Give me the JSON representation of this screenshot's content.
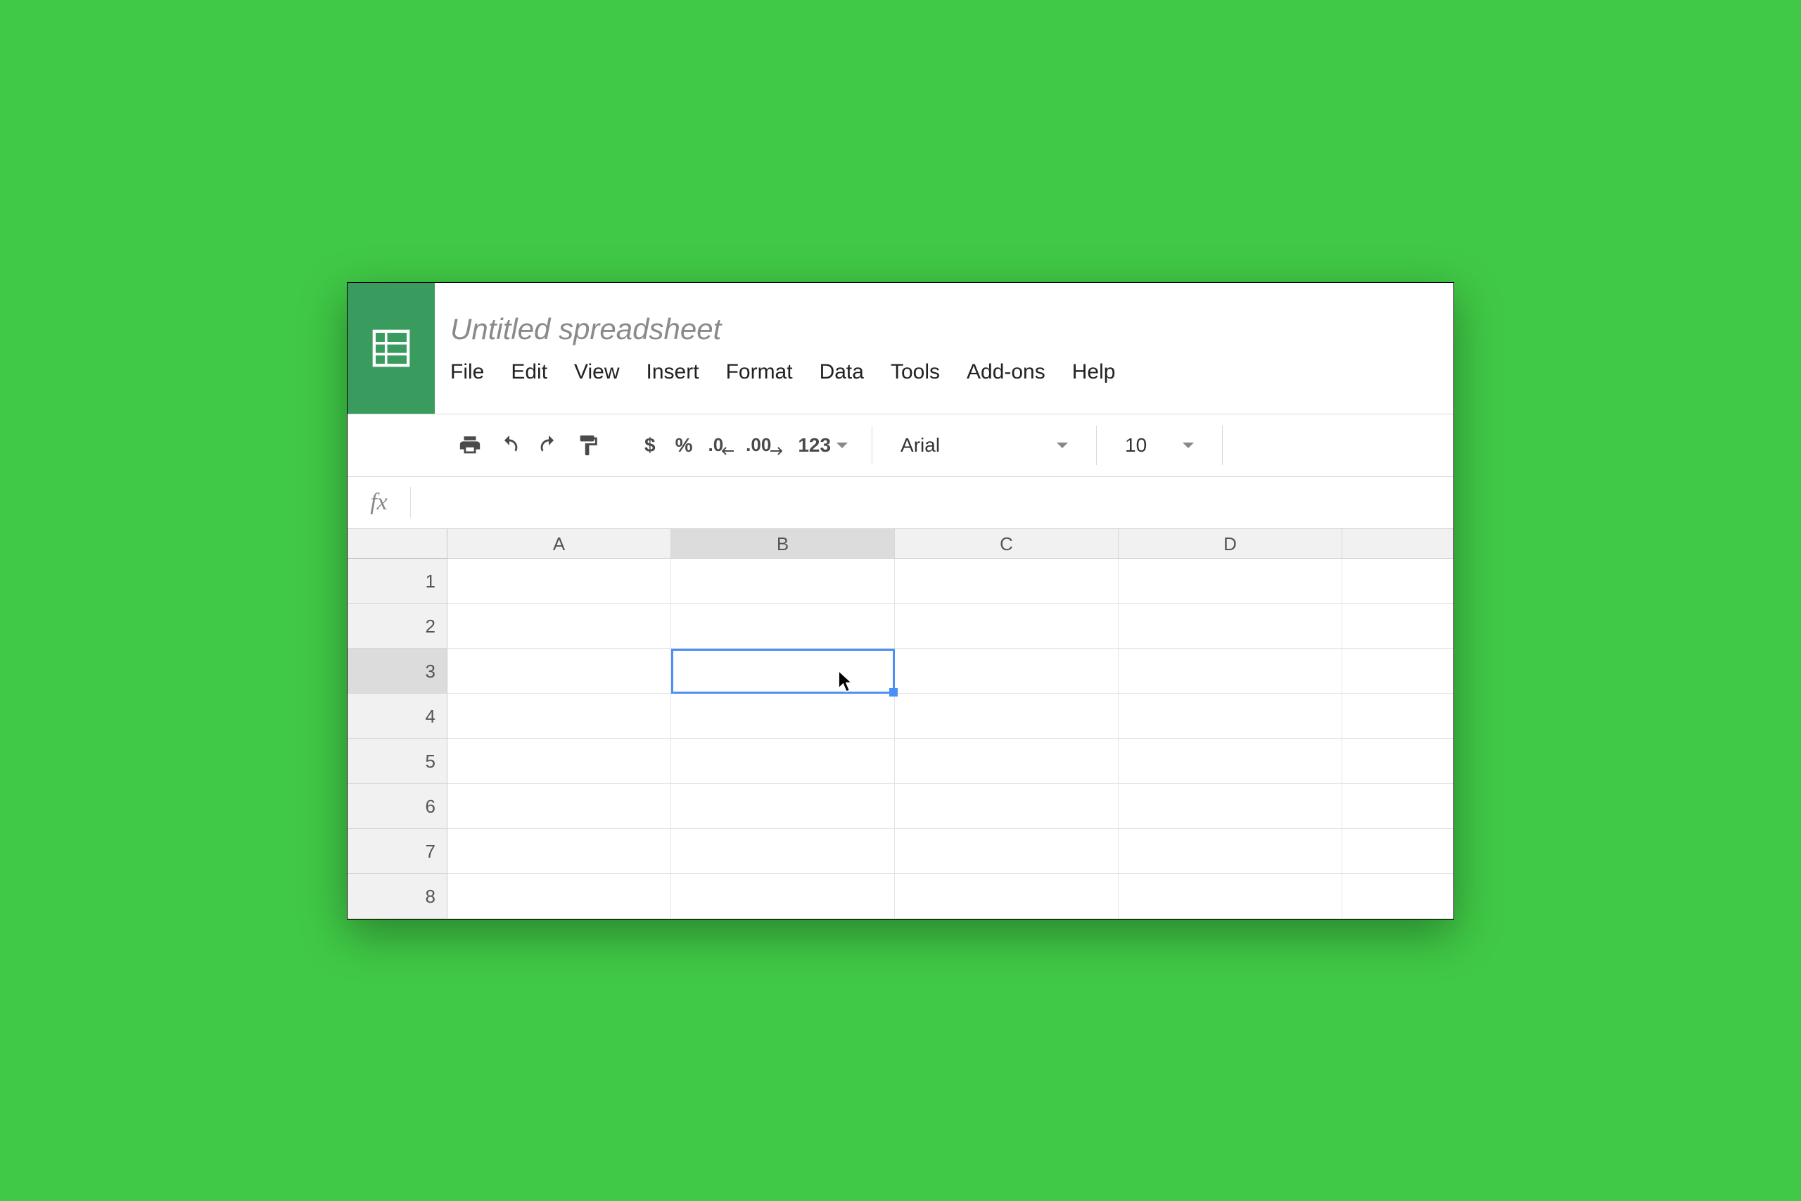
{
  "doc_title": "Untitled spreadsheet",
  "menu": {
    "file": "File",
    "edit": "Edit",
    "view": "View",
    "insert": "Insert",
    "format": "Format",
    "data": "Data",
    "tools": "Tools",
    "addons": "Add-ons",
    "help": "Help"
  },
  "toolbar": {
    "currency": "$",
    "percent": "%",
    "dec_decimal": ".0",
    "inc_decimal": ".00",
    "more_formats": "123",
    "font_name": "Arial",
    "font_size": "10"
  },
  "formula_bar": {
    "fx": "fx",
    "value": ""
  },
  "columns": [
    "A",
    "B",
    "C",
    "D"
  ],
  "rows": [
    "1",
    "2",
    "3",
    "4",
    "5",
    "6",
    "7",
    "8"
  ],
  "selection": {
    "col": "B",
    "row": "3"
  }
}
